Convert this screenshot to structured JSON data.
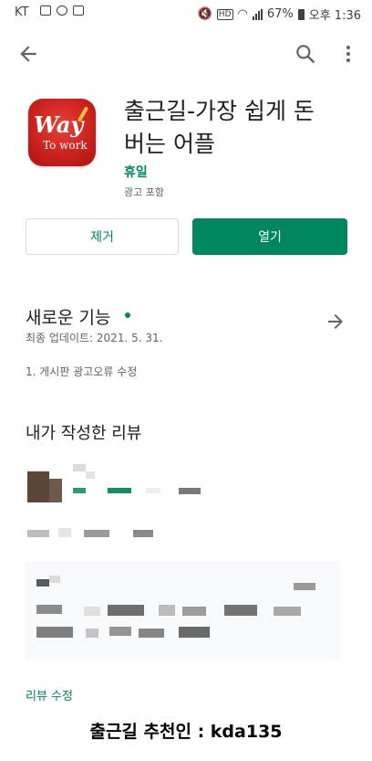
{
  "status_bar": {
    "carrier": "KT",
    "battery": "67%",
    "time": "오후 1:36"
  },
  "toolbar": {
    "back_icon": "arrow-left-icon",
    "search_icon": "search-icon",
    "more_icon": "more-vert-icon"
  },
  "app": {
    "title": "출근길-가장 쉽게 돈버는 어플",
    "developer": "휴일",
    "ads_label": "광고 포함",
    "icon_text": "Way",
    "icon_subtext": "To work"
  },
  "actions": {
    "uninstall_label": "제거",
    "open_label": "열기"
  },
  "whats_new": {
    "title": "새로운 기능",
    "last_updated": "최종 업데이트: 2021. 5. 31.",
    "body": "1. 게시판 광고오류 수정"
  },
  "my_review": {
    "title": "내가 작성한 리뷰",
    "edit_label": "리뷰 수정"
  },
  "caption": "출근길 추천인 : kda135",
  "colors": {
    "accent": "#01875f",
    "icon_red": "#d32a23"
  }
}
